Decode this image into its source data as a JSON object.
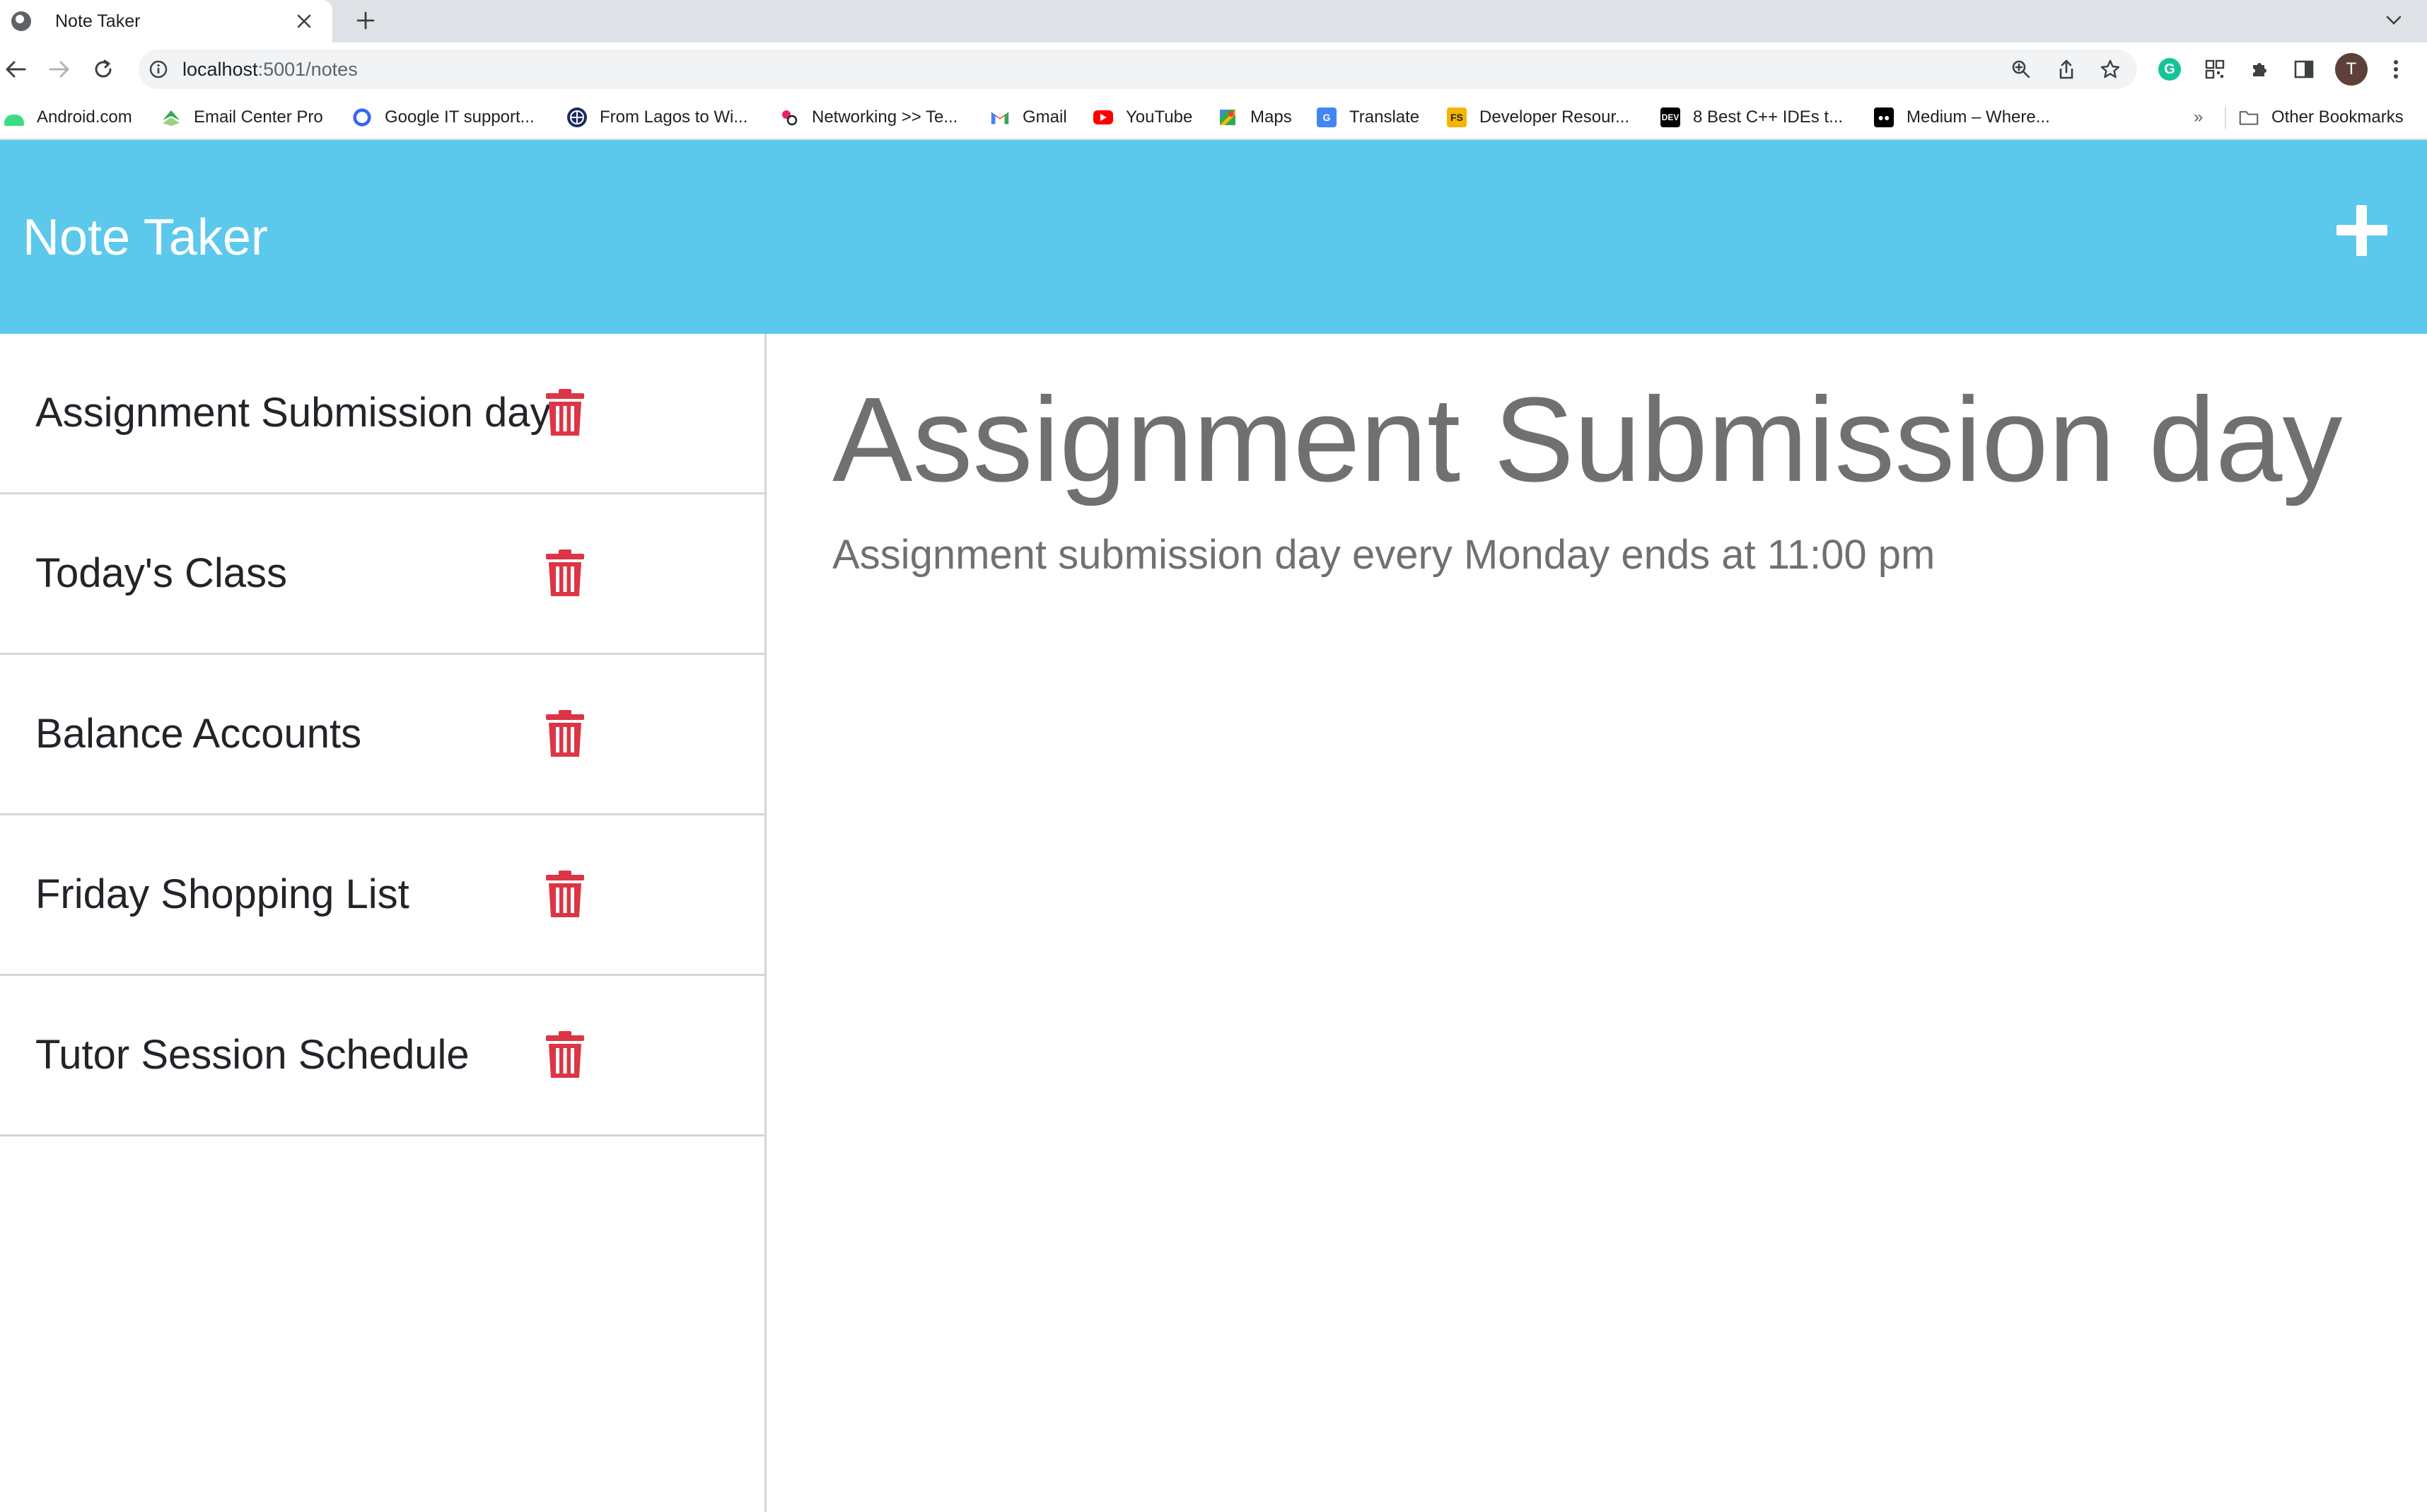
{
  "browser": {
    "tab_title": "Note Taker",
    "url_host": "localhost",
    "url_path": ":5001/notes",
    "avatar_initial": "T",
    "bookmarks": [
      {
        "label": "Android.com",
        "icon": "android-icon",
        "color": "#3ddc84"
      },
      {
        "label": "Email Center Pro",
        "icon": "email-center-icon",
        "color": "#34a853"
      },
      {
        "label": "Google IT support...",
        "icon": "coursera-icon",
        "color": "#3a63f6"
      },
      {
        "label": "From Lagos to Wi...",
        "icon": "globe-icon",
        "color": "#1a2b5f"
      },
      {
        "label": "Networking >> Te...",
        "icon": "networking-icon",
        "color": "#e8245c"
      },
      {
        "label": "Gmail",
        "icon": "gmail-icon",
        "color": "#ea4335"
      },
      {
        "label": "YouTube",
        "icon": "youtube-icon",
        "color": "#ff0000"
      },
      {
        "label": "Maps",
        "icon": "maps-icon",
        "color": "#34a853"
      },
      {
        "label": "Translate",
        "icon": "translate-icon",
        "color": "#4285f4"
      },
      {
        "label": "Developer Resour...",
        "icon": "fs-icon",
        "color": "#f4b400"
      },
      {
        "label": "8 Best C++ IDEs t...",
        "icon": "dev-icon",
        "color": "#000000"
      },
      {
        "label": "Medium – Where...",
        "icon": "medium-icon",
        "color": "#000000"
      }
    ],
    "bookmarks_overflow": "»",
    "other_bookmarks": "Other Bookmarks"
  },
  "app": {
    "title": "Note Taker",
    "header_color": "#5bc8ec",
    "add_icon": "plus-icon"
  },
  "notes": [
    {
      "title": "Assignment Submission day"
    },
    {
      "title": "Today's Class"
    },
    {
      "title": "Balance Accounts"
    },
    {
      "title": "Friday Shopping List"
    },
    {
      "title": "Tutor Session Schedule"
    }
  ],
  "delete_icon": "trash-icon",
  "delete_color": "#dc3545",
  "active_note": {
    "title": "Assignment Submission day",
    "text": "Assignment submission day every Monday ends at 11:00 pm"
  }
}
